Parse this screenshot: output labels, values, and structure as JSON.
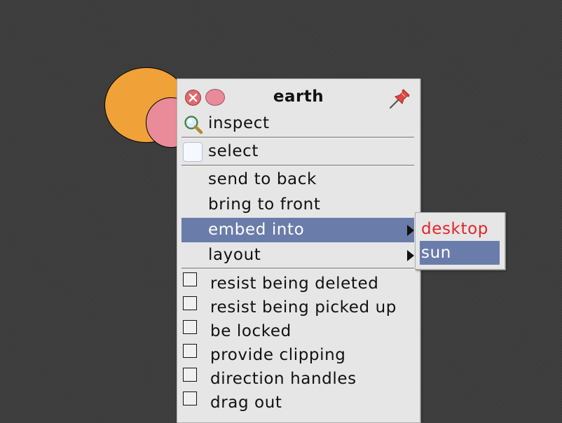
{
  "canvas": {
    "morphs": [
      {
        "name": "sun",
        "color": "#f0a137"
      },
      {
        "name": "earth",
        "color": "#e98b99"
      }
    ]
  },
  "menu": {
    "title": "earth",
    "title_icons": [
      "close-icon",
      "collapse-icon",
      "pin-icon"
    ],
    "items": [
      {
        "label": "inspect",
        "icon": "inspect-icon"
      },
      {
        "label": "select",
        "icon": "select-icon"
      },
      {
        "label": "send to back"
      },
      {
        "label": "bring to front"
      },
      {
        "label": "embed into",
        "submenu": true,
        "highlighted": true
      },
      {
        "label": "layout",
        "submenu": true
      }
    ],
    "checkboxes": [
      {
        "label": "resist being deleted",
        "checked": false
      },
      {
        "label": "resist being picked up",
        "checked": false
      },
      {
        "label": "be locked",
        "checked": false
      },
      {
        "label": "provide clipping",
        "checked": false
      },
      {
        "label": "direction handles",
        "checked": false
      },
      {
        "label": "drag out",
        "checked": false
      }
    ]
  },
  "submenu": {
    "items": [
      {
        "label": "desktop",
        "color": "#e0262a"
      },
      {
        "label": "sun",
        "highlighted": true
      }
    ]
  },
  "colors": {
    "highlight": "#6a7ca9",
    "menu_bg": "#e6e6e6",
    "desktop_bg": "#3d3d3d"
  }
}
